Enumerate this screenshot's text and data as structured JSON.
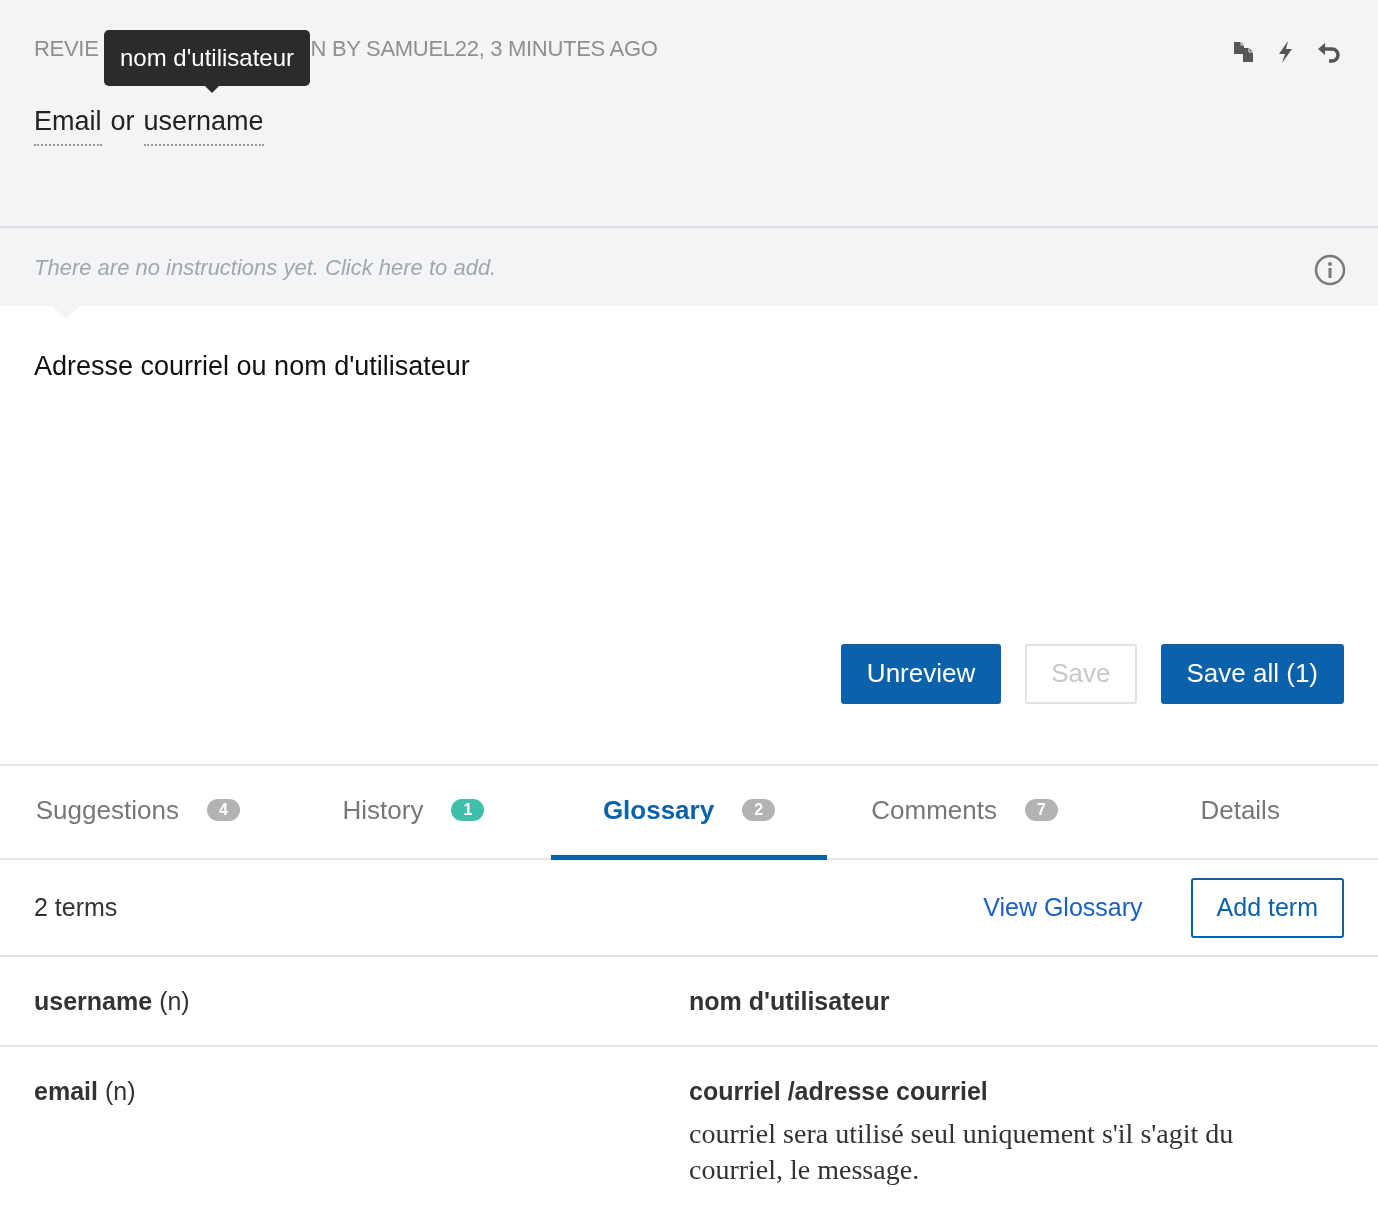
{
  "source": {
    "status_parts": [
      "REVIE",
      "N BY SAMUEL22, 3 MINUTES AGO"
    ],
    "tooltip": "nom d'utilisateur",
    "words": [
      {
        "text": "Email",
        "term": true
      },
      {
        "text": "or",
        "term": false
      },
      {
        "text": "username",
        "term": true
      }
    ],
    "actions": [
      {
        "kind": "copy"
      },
      {
        "kind": "bolt"
      },
      {
        "kind": "undo"
      }
    ]
  },
  "instructions": {
    "placeholder": "There are no instructions yet. Click here to add."
  },
  "translation": {
    "value": "Adresse courriel ou nom d'utilisateur"
  },
  "buttons": [
    {
      "label": "Unreview",
      "disabled": false
    },
    {
      "label": "Save",
      "disabled": true
    },
    {
      "label": "Save all (1)",
      "disabled": false
    }
  ],
  "tabs": [
    {
      "label": "Suggestions",
      "count": "4",
      "selected": false,
      "color": "#b3b3b3"
    },
    {
      "label": "History",
      "count": "1",
      "selected": false,
      "color": "#3fbfab"
    },
    {
      "label": "Glossary",
      "count": "2",
      "selected": true,
      "color": "#b3b3b3"
    },
    {
      "label": "Comments",
      "count": "7",
      "selected": false,
      "color": "#b3b3b3"
    },
    {
      "label": "Details",
      "selected": false
    }
  ],
  "glossary": {
    "summary": "2 terms",
    "view_link": "View Glossary",
    "add_button": "Add term",
    "rows": [
      {
        "term": "username",
        "pos": "(n)",
        "translation": "nom d'utilisateur"
      },
      {
        "term": "email",
        "pos": "(n)",
        "translation": "courriel /adresse courriel",
        "note": "courriel sera utilisé seul uniquement s'il s'agit du courriel, le message."
      }
    ]
  }
}
